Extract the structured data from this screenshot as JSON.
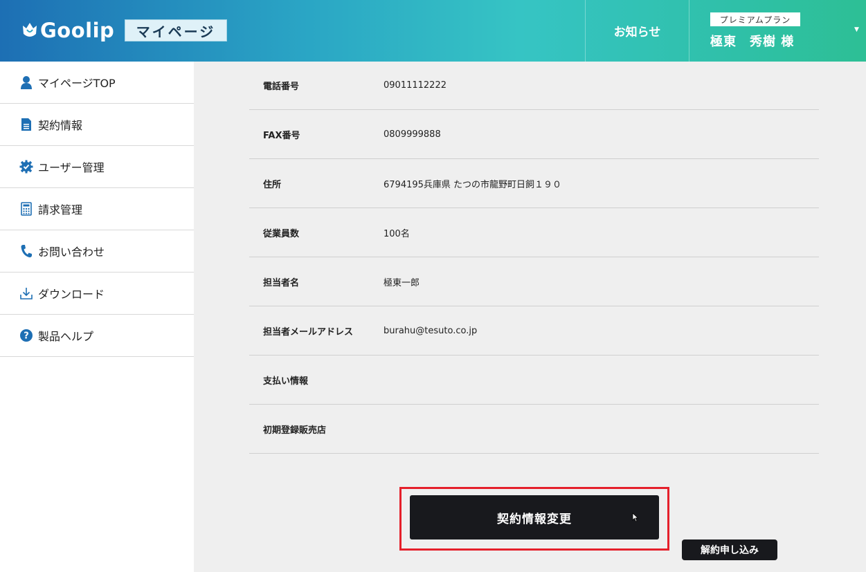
{
  "header": {
    "logo_text": "Goolip",
    "mypage_label": "マイページ",
    "notice_label": "お知らせ",
    "plan_label": "プレミアムプラン",
    "user_name": "極東　秀樹 様"
  },
  "sidebar": {
    "items": [
      {
        "label": "マイページTOP",
        "icon": "user-icon"
      },
      {
        "label": "契約情報",
        "icon": "document-icon"
      },
      {
        "label": "ユーザー管理",
        "icon": "gear-check-icon"
      },
      {
        "label": "請求管理",
        "icon": "calculator-icon"
      },
      {
        "label": "お問い合わせ",
        "icon": "phone-icon"
      },
      {
        "label": "ダウンロード",
        "icon": "download-icon"
      },
      {
        "label": "製品ヘルプ",
        "icon": "help-icon"
      }
    ]
  },
  "info_rows": [
    {
      "label": "電話番号",
      "value": "09011112222"
    },
    {
      "label": "FAX番号",
      "value": "0809999888"
    },
    {
      "label": "住所",
      "value": "6794195兵庫県 たつの市龍野町日飼１９０"
    },
    {
      "label": "従業員数",
      "value": "100名"
    },
    {
      "label": "担当者名",
      "value": "極東一郎"
    },
    {
      "label": "担当者メールアドレス",
      "value": "burahu@tesuto.co.jp"
    },
    {
      "label": "支払い情報",
      "value": ""
    },
    {
      "label": "初期登録販売店",
      "value": ""
    }
  ],
  "actions": {
    "change_label": "契約情報変更",
    "cancel_label": "解約申し込み"
  },
  "colors": {
    "header_gradient_start": "#1d6fb4",
    "header_gradient_end": "#2dbf95",
    "button_dark": "#18191d",
    "highlight_red": "#e5202b",
    "icon_blue": "#1e6fb4"
  }
}
